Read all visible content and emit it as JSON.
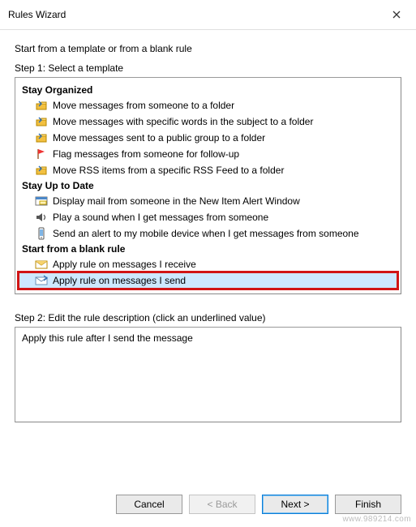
{
  "window": {
    "title": "Rules Wizard"
  },
  "intro": "Start from a template or from a blank rule",
  "step1_label": "Step 1: Select a template",
  "categories": {
    "stay_organized": {
      "header": "Stay Organized",
      "items": [
        {
          "icon": "move-to-folder-icon",
          "label": "Move messages from someone to a folder"
        },
        {
          "icon": "move-to-folder-icon",
          "label": "Move messages with specific words in the subject to a folder"
        },
        {
          "icon": "move-to-folder-icon",
          "label": "Move messages sent to a public group to a folder"
        },
        {
          "icon": "flag-icon",
          "label": "Flag messages from someone for follow-up"
        },
        {
          "icon": "move-to-folder-icon",
          "label": "Move RSS items from a specific RSS Feed to a folder"
        }
      ]
    },
    "stay_up_to_date": {
      "header": "Stay Up to Date",
      "items": [
        {
          "icon": "alert-window-icon",
          "label": "Display mail from someone in the New Item Alert Window"
        },
        {
          "icon": "sound-icon",
          "label": "Play a sound when I get messages from someone"
        },
        {
          "icon": "mobile-icon",
          "label": "Send an alert to my mobile device when I get messages from someone"
        }
      ]
    },
    "start_from_blank": {
      "header": "Start from a blank rule",
      "items": [
        {
          "icon": "mail-in-icon",
          "label": "Apply rule on messages I receive"
        },
        {
          "icon": "mail-out-icon",
          "label": "Apply rule on messages I send",
          "selected": true
        }
      ]
    }
  },
  "step2_label": "Step 2: Edit the rule description (click an underlined value)",
  "description_text": "Apply this rule after I send the message",
  "buttons": {
    "cancel": "Cancel",
    "back": "< Back",
    "next": "Next >",
    "finish": "Finish"
  },
  "watermark": "www.989214.com"
}
